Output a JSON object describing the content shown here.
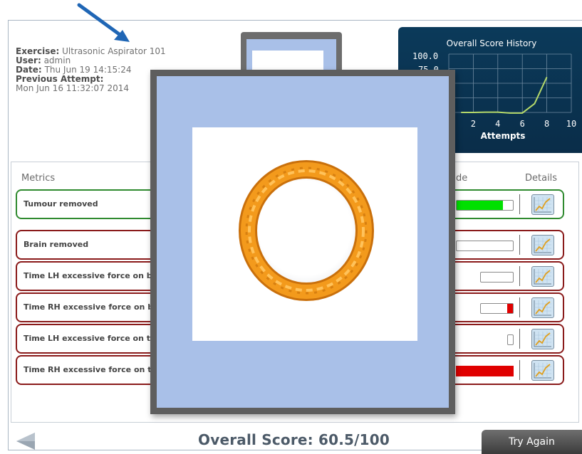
{
  "exercise_info": {
    "exercise_label": "Exercise:",
    "exercise_value": "Ultrasonic Aspirator 101",
    "user_label": "User:",
    "user_value": "admin",
    "date_label": "Date:",
    "date_value": "Thu Jun 19 14:15:24",
    "previous_label": "Previous Attempt:",
    "previous_value": "Mon Jun 16 11:32:07 2014"
  },
  "history_chart": {
    "title": "Overall Score History",
    "y_ticks": [
      "100.0",
      "75.0"
    ],
    "x_ticks": [
      "2",
      "4",
      "6",
      "8",
      "10"
    ],
    "x_label": "Attempts",
    "line_color": "#b5d96a"
  },
  "chart_data": {
    "type": "line",
    "title": "Overall Score History",
    "xlabel": "Attempts",
    "ylabel": "",
    "xlim": [
      0,
      10
    ],
    "ylim": [
      0,
      100
    ],
    "series": [
      {
        "values": [
          [
            1,
            0
          ],
          [
            2,
            0
          ],
          [
            3,
            0.5
          ],
          [
            4,
            0.5
          ],
          [
            5,
            -1
          ],
          [
            6,
            -1
          ],
          [
            7,
            15
          ],
          [
            8,
            60.5
          ]
        ]
      }
    ]
  },
  "metrics": {
    "header_metrics": "Metrics",
    "header_grade": "de",
    "header_details": "Details",
    "rows": [
      {
        "label": "Tumour removed",
        "status": "pass",
        "bar_fill": 0.8,
        "fill_color": "#00e000"
      },
      {
        "label": "Brain removed",
        "status": "fail",
        "bar_fill": 0.0,
        "fill_color": "#e00000"
      },
      {
        "label": "Time LH excessive force on brai",
        "status": "fail",
        "bar_fill": 0.0,
        "fill_color": "#e00000"
      },
      {
        "label": "Time RH excessive force on brai",
        "status": "fail",
        "bar_fill": 0.18,
        "fill_color": "#e00000"
      },
      {
        "label": "Time LH excessive force on tum",
        "status": "fail",
        "bar_fill": 0.0,
        "fill_color": "#e00000"
      },
      {
        "label": "Time RH excessive force on tum",
        "status": "fail",
        "bar_fill": 1.0,
        "fill_color": "#e00000"
      }
    ]
  },
  "footer": {
    "overall_score": "Overall Score: 60.5/100",
    "try_again_label": "Try Again"
  },
  "colors": {
    "pass_border": "#2f8a2f",
    "fail_border": "#8a1a1a",
    "overlay_blue": "#a9c0e8",
    "ring_orange": "#f39a1c"
  }
}
